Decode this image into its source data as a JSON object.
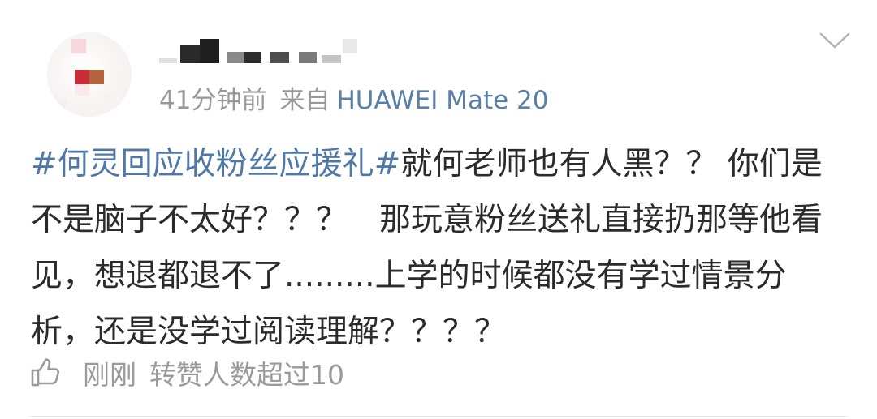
{
  "post": {
    "time": "41分钟前",
    "source_prefix": "来自",
    "device": "HUAWEI Mate 20",
    "hashtag": "#何灵回应收粉丝应援礼#",
    "body": "就何老师也有人黑？？ 你们是不是脑子不太好？？？　那玩意粉丝送礼直接扔那等他看见，想退都退不了.........上学的时候都没有学过情景分析，还是没学过阅读理解？？？？",
    "like_time": "刚刚",
    "repost_info": "转赞人数超过10"
  },
  "colors": {
    "link": "#4f78a6",
    "text": "#2b2b2b",
    "muted": "#999999"
  },
  "icons": {
    "expand": "chevron-down-icon",
    "like": "thumbs-up-icon"
  }
}
